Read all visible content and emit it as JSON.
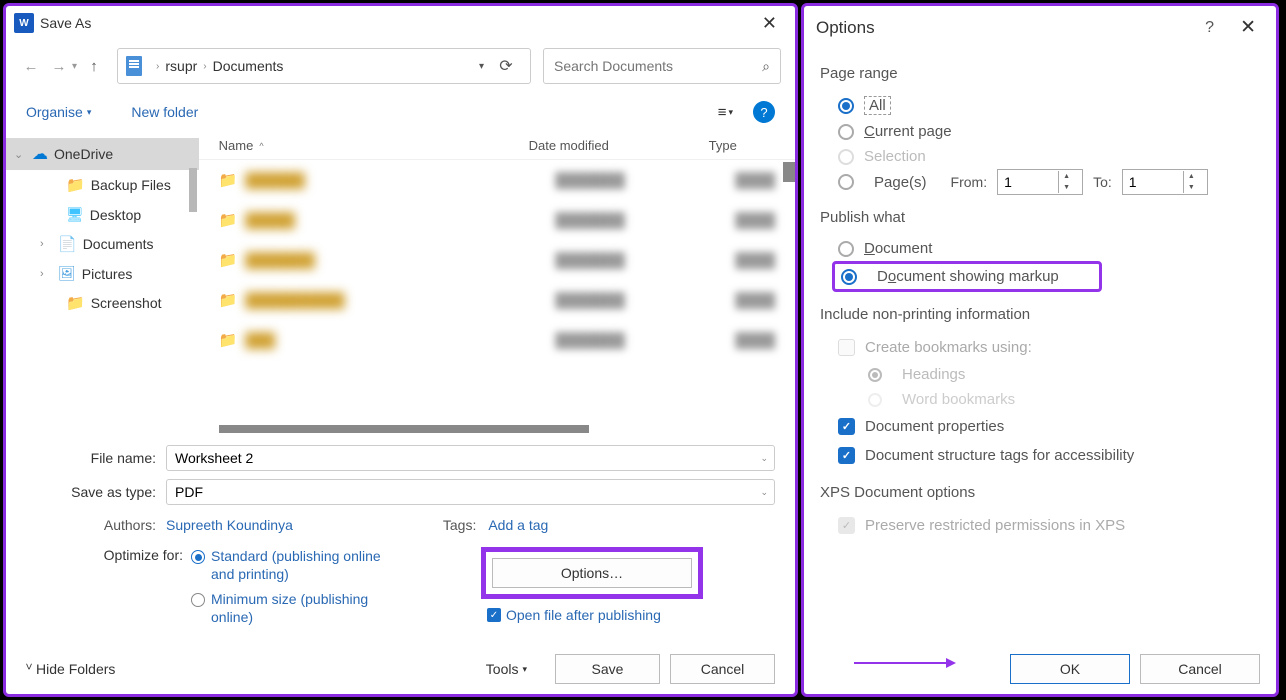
{
  "saveAs": {
    "title": "Save As",
    "nav": {
      "back": "←",
      "forward": "→",
      "up": "↑"
    },
    "breadcrumb": {
      "seg1": "rsupr",
      "seg2": "Documents"
    },
    "search": {
      "placeholder": "Search Documents"
    },
    "toolbar": {
      "organise": "Organise",
      "newFolder": "New folder"
    },
    "tree": {
      "onedrive": "OneDrive",
      "backup": "Backup Files",
      "desktop": "Desktop",
      "documents": "Documents",
      "pictures": "Pictures",
      "screenshot": "Screenshot"
    },
    "headers": {
      "name": "Name",
      "date": "Date modified",
      "type": "Type"
    },
    "form": {
      "fileNameLabel": "File name:",
      "fileName": "Worksheet 2",
      "saveTypeLabel": "Save as type:",
      "saveType": "PDF",
      "authorsLabel": "Authors:",
      "authors": "Supreeth Koundinya",
      "tagsLabel": "Tags:",
      "tagsLink": "Add a tag",
      "optimizeLabel": "Optimize for:",
      "optStandard": "Standard (publishing online and printing)",
      "optMin": "Minimum size (publishing online)",
      "optionsBtn": "Options…",
      "openAfter": "Open file after publishing"
    },
    "footer": {
      "hide": "Hide Folders",
      "tools": "Tools",
      "save": "Save",
      "cancel": "Cancel"
    }
  },
  "options": {
    "title": "Options",
    "pageRange": {
      "title": "Page range",
      "all": "All",
      "currentPage": "Current page",
      "selection": "Selection",
      "pages": "Page(s)",
      "from": "From:",
      "fromVal": "1",
      "to": "To:",
      "toVal": "1"
    },
    "publish": {
      "title": "Publish what",
      "document": "Document",
      "markup": "Document showing markup"
    },
    "nonPrinting": {
      "title": "Include non-printing information",
      "bookmarks": "Create bookmarks using:",
      "headings": "Headings",
      "wordBm": "Word bookmarks",
      "docProps": "Document properties",
      "structTags": "Document structure tags for accessibility"
    },
    "xps": {
      "title": "XPS Document options",
      "preserve": "Preserve restricted permissions in XPS"
    },
    "footer": {
      "ok": "OK",
      "cancel": "Cancel"
    }
  }
}
